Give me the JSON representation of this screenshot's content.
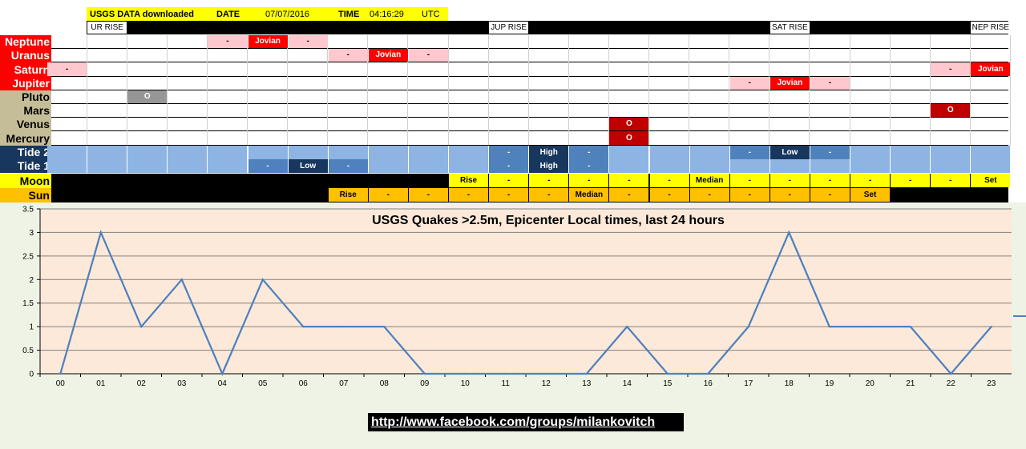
{
  "header": {
    "source_label": "USGS DATA downloaded",
    "date_label": "DATE",
    "date_value": "07/07/2016",
    "time_label": "TIME",
    "time_value": "04:16:29",
    "tz": "UTC"
  },
  "rise_labels": [
    {
      "text": "UR RISE",
      "col": 1
    },
    {
      "text": "JUP RISE",
      "col": 11
    },
    {
      "text": "SAT RISE",
      "col": 18
    },
    {
      "text": "NEP RISE",
      "col": 23
    }
  ],
  "rows": [
    {
      "label": "Neptune",
      "label_bg": "#ff0000",
      "label_color": "#ffffff",
      "cells": [
        {
          "col": 4,
          "text": "-",
          "bg": "#ffc7ce",
          "color": "#000000"
        },
        {
          "col": 5,
          "text": "Jovian",
          "bg": "#ff0000",
          "color": "#ffffff"
        },
        {
          "col": 6,
          "text": "-",
          "bg": "#ffc7ce",
          "color": "#000000"
        }
      ]
    },
    {
      "label": "Uranus",
      "label_bg": "#ff0000",
      "label_color": "#ffffff",
      "cells": [
        {
          "col": 7,
          "text": "-",
          "bg": "#ffc7ce",
          "color": "#000000"
        },
        {
          "col": 8,
          "text": "Jovian",
          "bg": "#ff0000",
          "color": "#ffffff"
        },
        {
          "col": 9,
          "text": "-",
          "bg": "#ffc7ce",
          "color": "#000000"
        }
      ]
    },
    {
      "label": "Saturn",
      "label_bg": "#ff0000",
      "label_color": "#ffffff",
      "cells": [
        {
          "col": 0,
          "text": "-",
          "bg": "#ffc7ce",
          "color": "#000000"
        },
        {
          "col": 22,
          "text": "-",
          "bg": "#ffc7ce",
          "color": "#000000"
        },
        {
          "col": 23,
          "text": "Jovian",
          "bg": "#ff0000",
          "color": "#ffffff"
        }
      ]
    },
    {
      "label": "Jupiter",
      "label_bg": "#ff0000",
      "label_color": "#ffffff",
      "cells": [
        {
          "col": 17,
          "text": "-",
          "bg": "#ffc7ce",
          "color": "#000000"
        },
        {
          "col": 18,
          "text": "Jovian",
          "bg": "#ff0000",
          "color": "#ffffff"
        },
        {
          "col": 19,
          "text": "-",
          "bg": "#ffc7ce",
          "color": "#000000"
        }
      ]
    },
    {
      "label": "Pluto",
      "label_bg": "#c4bd97",
      "label_color": "#000000",
      "cells": [
        {
          "col": 2,
          "text": "O",
          "bg": "#969696",
          "color": "#ffffff"
        }
      ]
    },
    {
      "label": "Mars",
      "label_bg": "#c4bd97",
      "label_color": "#000000",
      "cells": [
        {
          "col": 22,
          "text": "O",
          "bg": "#c00000",
          "color": "#ffffff"
        }
      ]
    },
    {
      "label": "Venus",
      "label_bg": "#c4bd97",
      "label_color": "#000000",
      "cells": [
        {
          "col": 14,
          "text": "O",
          "bg": "#c00000",
          "color": "#ffffff"
        }
      ]
    },
    {
      "label": "Mercury",
      "label_bg": "#c4bd97",
      "label_color": "#000000",
      "cells": [
        {
          "col": 14,
          "text": "O",
          "bg": "#c00000",
          "color": "#ffffff"
        }
      ]
    }
  ],
  "tide": {
    "label_bg": "#17375e",
    "label_color": "#ffffff",
    "base_color": "#8db4e2",
    "tide2_label": "Tide 2",
    "tide1_label": "Tide 1",
    "tide2_cells": [
      {
        "col": 11,
        "text": "-",
        "bg": "#4f81bd",
        "color": "#ffffff"
      },
      {
        "col": 12,
        "text": "High",
        "bg": "#17375e",
        "color": "#ffffff"
      },
      {
        "col": 13,
        "text": "-",
        "bg": "#4f81bd",
        "color": "#ffffff"
      },
      {
        "col": 17,
        "text": "-",
        "bg": "#4f81bd",
        "color": "#ffffff"
      },
      {
        "col": 18,
        "text": "Low",
        "bg": "#17375e",
        "color": "#ffffff"
      },
      {
        "col": 19,
        "text": "-",
        "bg": "#4f81bd",
        "color": "#ffffff"
      }
    ],
    "tide1_cells": [
      {
        "col": 5,
        "text": "-",
        "bg": "#4f81bd",
        "color": "#ffffff"
      },
      {
        "col": 6,
        "text": "Low",
        "bg": "#17375e",
        "color": "#ffffff"
      },
      {
        "col": 7,
        "text": "-",
        "bg": "#4f81bd",
        "color": "#ffffff"
      },
      {
        "col": 11,
        "text": "-",
        "bg": "#4f81bd",
        "color": "#ffffff"
      },
      {
        "col": 12,
        "text": "High",
        "bg": "#17375e",
        "color": "#ffffff"
      },
      {
        "col": 13,
        "text": "-",
        "bg": "#4f81bd",
        "color": "#ffffff"
      }
    ]
  },
  "moon": {
    "label": "Moon",
    "label_bg": "#ffff00",
    "label_color": "#000000",
    "dark_color": "#000000",
    "lit_color": "#ffff00",
    "lit_from_col": 10,
    "lit_to_col": 23,
    "cells": [
      {
        "col": 10,
        "text": "Rise"
      },
      {
        "col": 11,
        "text": "-"
      },
      {
        "col": 12,
        "text": "-"
      },
      {
        "col": 13,
        "text": "-"
      },
      {
        "col": 14,
        "text": "-"
      },
      {
        "col": 15,
        "text": "-"
      },
      {
        "col": 16,
        "text": "Median"
      },
      {
        "col": 17,
        "text": "-"
      },
      {
        "col": 18,
        "text": "-"
      },
      {
        "col": 19,
        "text": "-"
      },
      {
        "col": 20,
        "text": "-"
      },
      {
        "col": 21,
        "text": "-"
      },
      {
        "col": 22,
        "text": "-"
      },
      {
        "col": 23,
        "text": "Set"
      }
    ]
  },
  "sun": {
    "label": "Sun",
    "label_bg": "#ffc000",
    "label_color": "#000000",
    "dark_color": "#000000",
    "lit_color": "#ffc000",
    "lit_from_col": 7,
    "lit_to_col": 20,
    "cells": [
      {
        "col": 7,
        "text": "Rise"
      },
      {
        "col": 8,
        "text": "-"
      },
      {
        "col": 9,
        "text": "-"
      },
      {
        "col": 10,
        "text": "-"
      },
      {
        "col": 11,
        "text": "-"
      },
      {
        "col": 12,
        "text": "-"
      },
      {
        "col": 13,
        "text": "Median"
      },
      {
        "col": 14,
        "text": "-"
      },
      {
        "col": 15,
        "text": "-"
      },
      {
        "col": 16,
        "text": "-"
      },
      {
        "col": 17,
        "text": "-"
      },
      {
        "col": 18,
        "text": "-"
      },
      {
        "col": 19,
        "text": "-"
      },
      {
        "col": 20,
        "text": "Set"
      }
    ]
  },
  "chart_data": {
    "type": "line",
    "title": "USGS Quakes >2.5m, Epicenter Local times, last 24 hours",
    "categories": [
      "00",
      "01",
      "02",
      "03",
      "04",
      "05",
      "06",
      "07",
      "08",
      "09",
      "10",
      "11",
      "12",
      "13",
      "14",
      "15",
      "16",
      "17",
      "18",
      "19",
      "20",
      "21",
      "22",
      "23"
    ],
    "series": [
      {
        "values": [
          0,
          3,
          1,
          2,
          0,
          2,
          1,
          1,
          1,
          0,
          0,
          0,
          0,
          0,
          1,
          0,
          0,
          1,
          3,
          1,
          1,
          1,
          0,
          1
        ]
      }
    ],
    "ylim": [
      0,
      3.5
    ],
    "yticks": [
      "0",
      "0.5",
      "1",
      "1.5",
      "2",
      "2.5",
      "3",
      "3.5"
    ],
    "grid": true,
    "xlabel": "",
    "ylabel": "",
    "plot_bg": "#fde9d9",
    "outer_bg": "#eef3e6",
    "line_color": "#4f81bd",
    "gridline_color": "#808080"
  },
  "footer": {
    "link_text": "http://www.facebook.com/groups/milankovitch"
  }
}
